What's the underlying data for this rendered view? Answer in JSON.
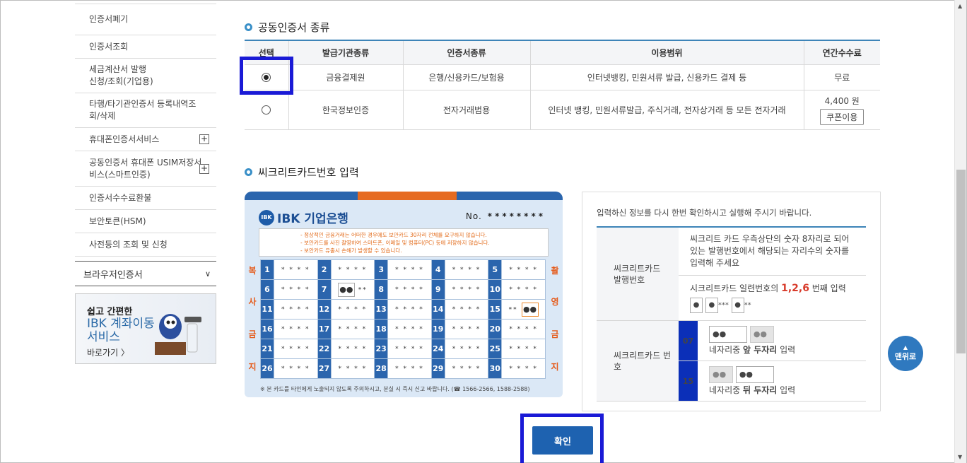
{
  "sidebar": {
    "items": [
      {
        "label": "인증서폐기"
      },
      {
        "label": "인증서조회"
      },
      {
        "label": "세금계산서 발행\n신청/조회(기업용)"
      },
      {
        "label": "타행/타기관인증서 등록내역조\n회/삭제"
      },
      {
        "label": "휴대폰인증서서비스",
        "expand": "+"
      },
      {
        "label": "공동인증서 휴대폰 USIM저장서\n비스(스마트인증)",
        "expand": "+"
      },
      {
        "label": "인증서수수료환불"
      },
      {
        "label": "보안토큰(HSM)"
      },
      {
        "label": "사전등의 조회 및 신청"
      }
    ],
    "browser_cert": "브라우저인증서",
    "banner": {
      "line1": "쉽고 간편한",
      "line2": "IBK 계좌이동\n서비스",
      "link": "바로가기 〉"
    }
  },
  "cert_section": {
    "title": "공동인증서 종류",
    "columns": [
      "선택",
      "발급기관종류",
      "인증서종류",
      "이용범위",
      "연간수수료"
    ],
    "rows": [
      {
        "selected": true,
        "issuer": "금융결제원",
        "type": "은행/신용카드/보험용",
        "scope": "인터넷뱅킹, 민원서류 발급, 신용카드 결제 등",
        "fee": "무료"
      },
      {
        "selected": false,
        "issuer": "한국정보인증",
        "type": "전자거래범용",
        "scope": "인터넷 뱅킹, 민원서류발급, 주식거래, 전자상거래 등 모든 전자거래",
        "fee": "4,400 원",
        "coupon": "쿠폰이용"
      }
    ]
  },
  "secure_section": {
    "title": "씨크리트카드번호 입력",
    "card": {
      "bank": "IBK 기업은행",
      "no_label": "No.",
      "no_value": "********",
      "notice": [
        "- 정상적인 금융거래는 어떠한 경우에도 보안카드 30자리 전체를 요구하지 않습니다.",
        "- 보안카드를 사진 촬영하여 스마트폰, 이메일 및 컴퓨터(PC) 등에 저장하지 않습니다.",
        "- 보안카드 유출시 손해가 발생할 수 있습니다."
      ],
      "left_chars": [
        "복",
        "사",
        "금",
        "지"
      ],
      "right_chars": [
        "촬",
        "영",
        "금",
        "지"
      ],
      "masked": "****",
      "footer": "※ 본 카드를 타인에게 노출되지 않도록 주의하시고, 분실 시 즉시 신고 바랍니다. (☎ 1566-2566, 1588-2588)",
      "cell7": "●●",
      "cell15": "●●"
    },
    "panel": {
      "message": "입력하신 정보를 다시 한번 확인하시고 실행해 주시기 바랍니다.",
      "issue_label": "씨크리트카드\n발행번호",
      "issue_desc": "씨크리트 카드 우측상단의 숫자 8자리로 되어 있는 발행번호에서 해당되는 자리수의 숫자를 입력해 주세요",
      "serial_pre": "시크리트카드 일련번호의 ",
      "serial_positions": "1,2,6",
      "serial_post": " 번째 입력",
      "pin_dot": "●",
      "pin_stars": "***",
      "pin_stars2": "**",
      "number_label": "씨크리트카드 번호",
      "row1": {
        "idx": "07",
        "value": "●●",
        "gray": "●●",
        "desc_pre": "네자리중 ",
        "desc_bold": "앞 두자리",
        "desc_post": " 입력"
      },
      "row2": {
        "idx": "15",
        "gray": "●●",
        "value": "●●",
        "desc_pre": "네자리중 ",
        "desc_bold": "뒤 두자리",
        "desc_post": " 입력"
      }
    }
  },
  "confirm": "확인",
  "top_button": "맨위로",
  "colors": {
    "accent": "#1e62b0",
    "highlight": "#1a1ad6",
    "index": "#0b2fb8"
  }
}
